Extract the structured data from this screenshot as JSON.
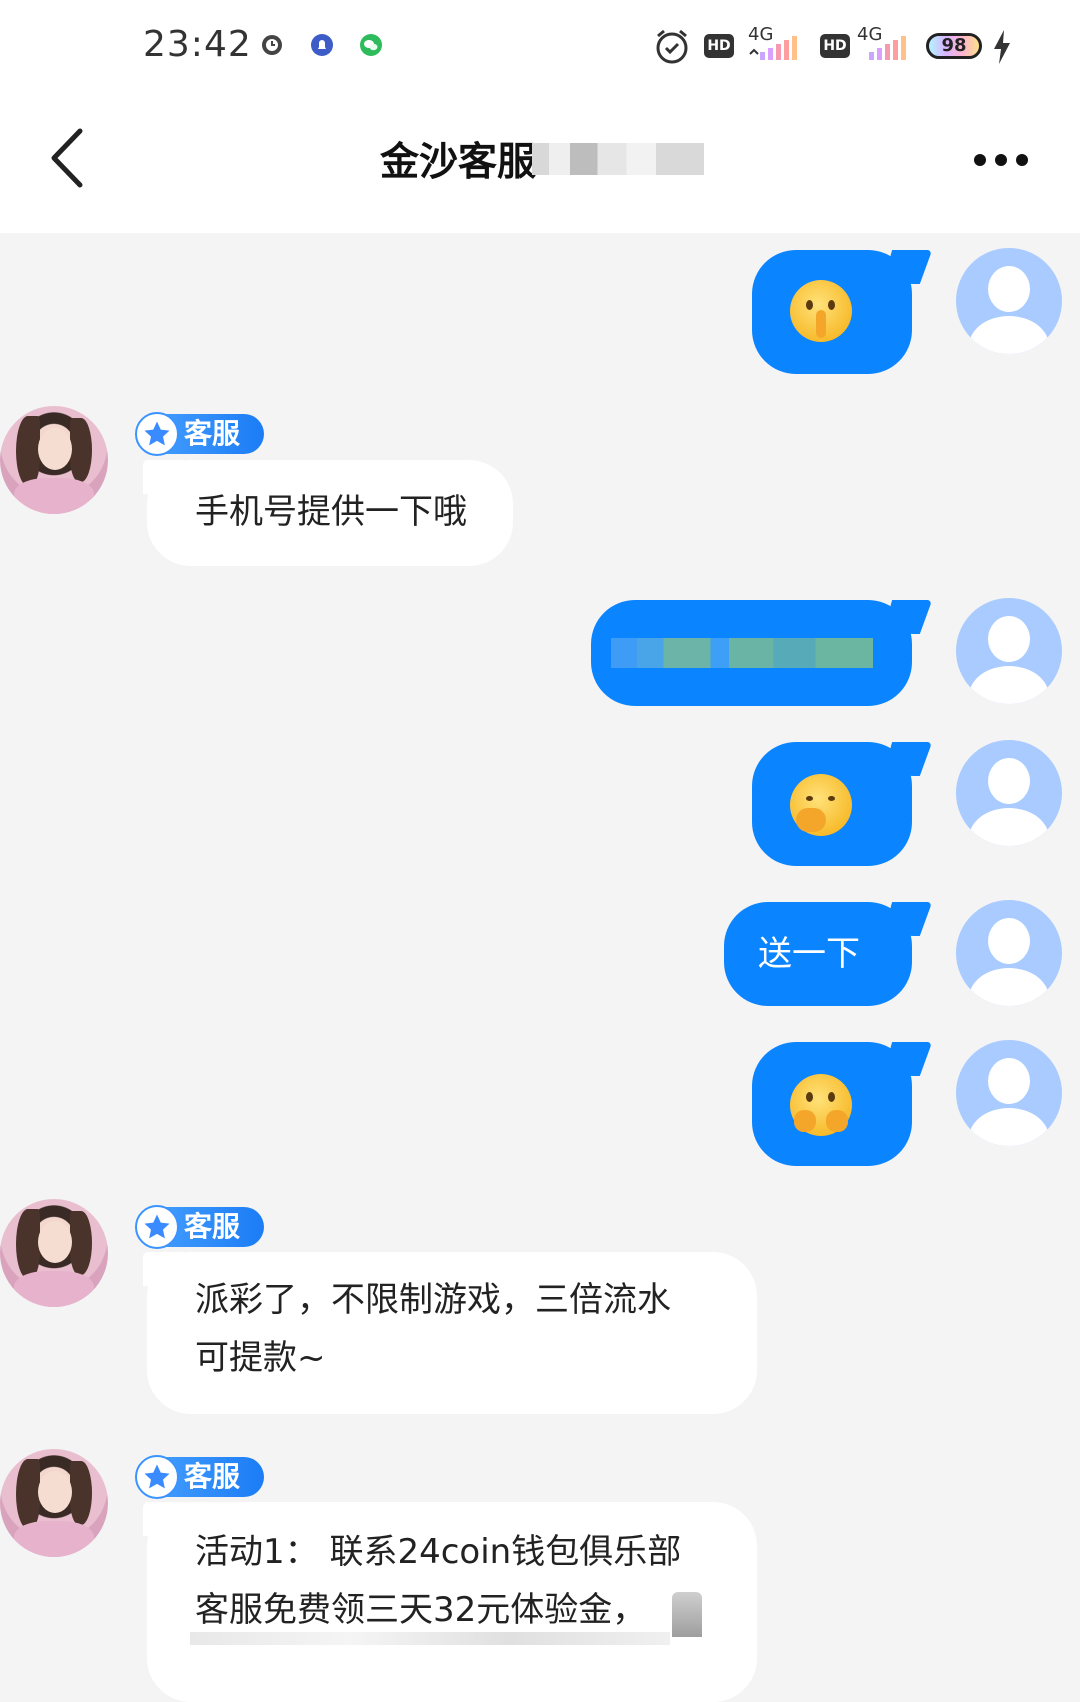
{
  "status_bar": {
    "time": "23:42",
    "icons": [
      "clock-icon",
      "notification-icon",
      "wechat-icon",
      "alarm-icon",
      "hd-icon",
      "signal-4g-icon",
      "hd-icon",
      "signal-4g-icon",
      "battery-icon",
      "charging-icon"
    ],
    "battery": "98",
    "network_label": "4G",
    "hd_label": "HD"
  },
  "header": {
    "title": "金沙客服",
    "back_icon": "chevron-left-icon",
    "more_icon": "more-horizontal-icon"
  },
  "colors": {
    "outgoing_bubble": "#0a84ff",
    "incoming_bubble": "#ffffff",
    "background": "#f4f4f5",
    "badge": "#1b7cf5"
  },
  "messages": [
    {
      "from": "me",
      "type": "emoji",
      "emoji": "shushing-face"
    },
    {
      "from": "agent",
      "badge": "客服",
      "text": "手机号提供一下哦"
    },
    {
      "from": "me",
      "type": "redacted"
    },
    {
      "from": "me",
      "type": "emoji",
      "emoji": "hand-over-mouth-face"
    },
    {
      "from": "me",
      "type": "text",
      "text": "送一下"
    },
    {
      "from": "me",
      "type": "emoji",
      "emoji": "hand-over-mouth-face"
    },
    {
      "from": "agent",
      "badge": "客服",
      "lines": [
        "派彩了，不限制游戏，三倍流水",
        "可提款~"
      ]
    },
    {
      "from": "agent",
      "badge": "客服",
      "lines": [
        "活动1：  联系24coin钱包俱乐部",
        "客服免费领三天32元体验金，"
      ]
    }
  ]
}
